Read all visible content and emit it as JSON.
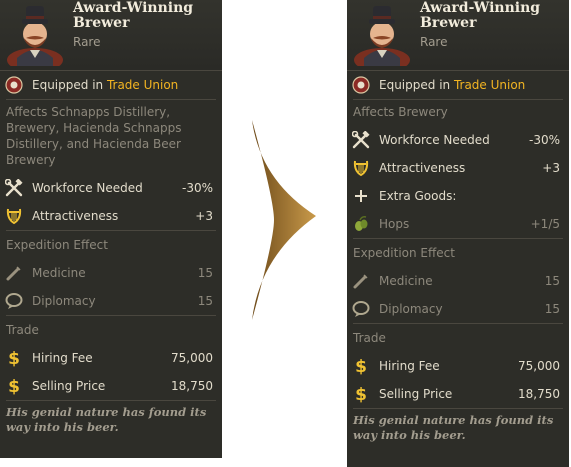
{
  "left": {
    "title": "Award-Winning Brewer",
    "rarity": "Rare",
    "equipped_prefix": "Equipped in ",
    "equipped_place": "Trade Union",
    "affects": "Affects Schnapps Distillery, Brewery, Hacienda Schnapps Distillery, and Hacienda Beer Brewery",
    "effects": [
      {
        "icon": "hammer-wrench-icon",
        "label": "Workforce Needed",
        "value": "-30%"
      },
      {
        "icon": "lyre-icon",
        "label": "Attractiveness",
        "value": "+3"
      }
    ],
    "expedition_title": "Expedition Effect",
    "expedition": [
      {
        "icon": "medicine-syringe-icon",
        "label": "Medicine",
        "value": "15"
      },
      {
        "icon": "diplomacy-speech-icon",
        "label": "Diplomacy",
        "value": "15"
      }
    ],
    "trade_title": "Trade",
    "trade": [
      {
        "icon": "dollar-icon",
        "label": "Hiring Fee",
        "value": "75,000"
      },
      {
        "icon": "dollar-icon",
        "label": "Selling Price",
        "value": "18,750"
      }
    ],
    "flavor": "His genial nature has found its way into his beer."
  },
  "right": {
    "title": "Award-Winning Brewer",
    "rarity": "Rare",
    "equipped_prefix": "Equipped in ",
    "equipped_place": "Trade Union",
    "affects": "Affects Brewery",
    "effects": [
      {
        "icon": "hammer-wrench-icon",
        "label": "Workforce Needed",
        "value": "-30%"
      },
      {
        "icon": "lyre-icon",
        "label": "Attractiveness",
        "value": "+3"
      }
    ],
    "extra_label": "Extra Goods:",
    "extra_good": {
      "icon": "hops-icon",
      "label": "Hops",
      "value": "+1/5"
    },
    "expedition_title": "Expedition Effect",
    "expedition": [
      {
        "icon": "medicine-syringe-icon",
        "label": "Medicine",
        "value": "15"
      },
      {
        "icon": "diplomacy-speech-icon",
        "label": "Diplomacy",
        "value": "15"
      }
    ],
    "trade_title": "Trade",
    "trade": [
      {
        "icon": "dollar-icon",
        "label": "Hiring Fee",
        "value": "75,000"
      },
      {
        "icon": "dollar-icon",
        "label": "Selling Price",
        "value": "18,750"
      }
    ],
    "flavor": "His genial nature has found its way into his beer."
  },
  "colors": {
    "panel": "#2d2d28",
    "gold": "#f2b422",
    "arrow": "#b98a3c"
  }
}
